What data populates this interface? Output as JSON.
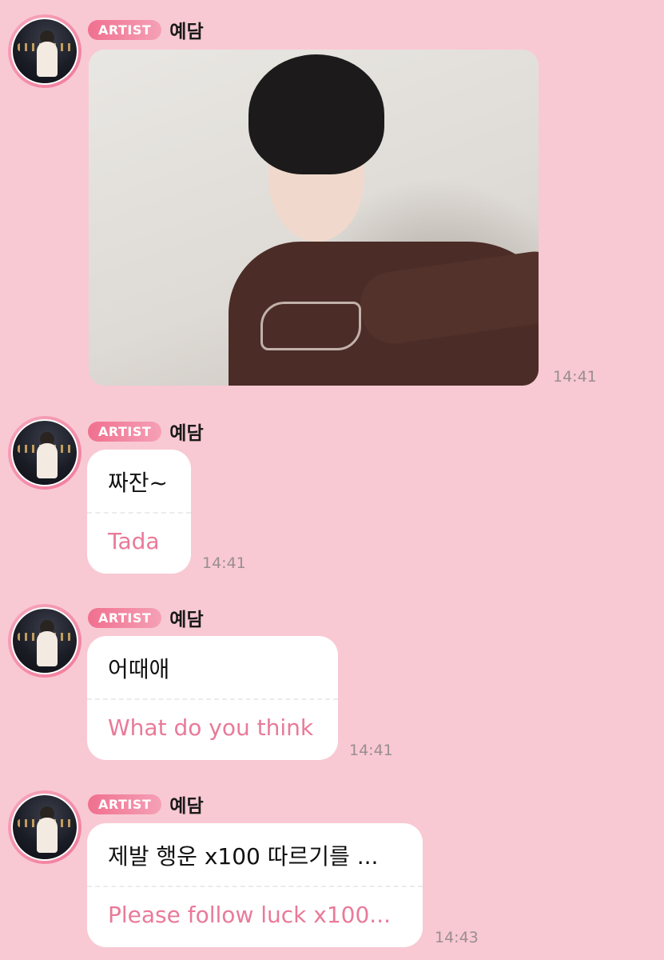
{
  "sender": {
    "badge": "ARTIST",
    "name": "예담"
  },
  "messages": [
    {
      "type": "image",
      "time": "14:41"
    },
    {
      "type": "text",
      "korean": "짜잔~",
      "english": "Tada",
      "time": "14:41"
    },
    {
      "type": "text",
      "korean": "어때애",
      "english": "What do you think",
      "time": "14:41"
    },
    {
      "type": "text",
      "korean": "제발 행운 x100 따르기를 ...",
      "english": "Please follow luck x100...",
      "time": "14:43"
    }
  ]
}
